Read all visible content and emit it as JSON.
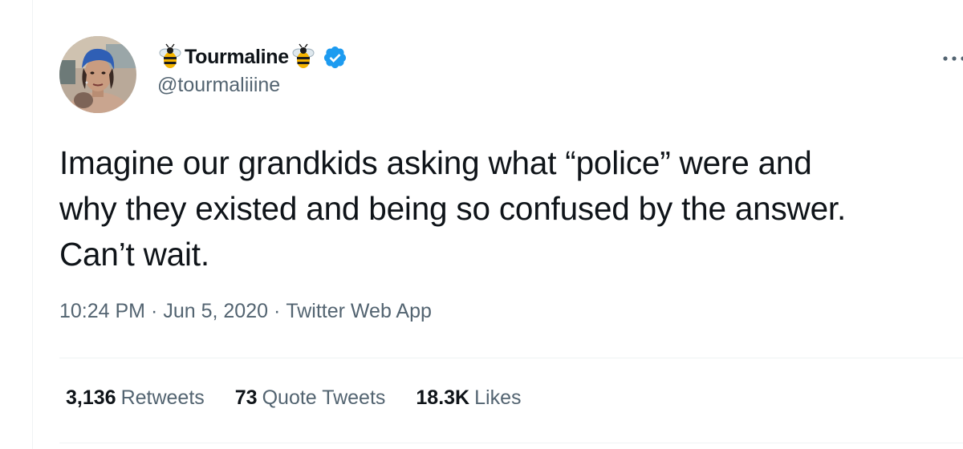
{
  "author": {
    "display_name": "Tourmaline",
    "handle": "@tourmaliiine",
    "name_emoji": "bee-icon",
    "verified": true
  },
  "tweet": {
    "text": "Imagine our grandkids asking what “police” were and\nwhy they existed and being so confused by the answer.\nCan’t wait.",
    "time": "10:24 PM",
    "separator": "·",
    "date": "Jun 5, 2020",
    "source": "Twitter Web App"
  },
  "stats": [
    {
      "value": "3,136",
      "label": "Retweets"
    },
    {
      "value": "73",
      "label": "Quote Tweets"
    },
    {
      "value": "18.3K",
      "label": "Likes"
    }
  ],
  "colors": {
    "text": "#0f1419",
    "secondary": "#536471",
    "verified": "#1d9bf0",
    "divider": "#eff3f4"
  }
}
